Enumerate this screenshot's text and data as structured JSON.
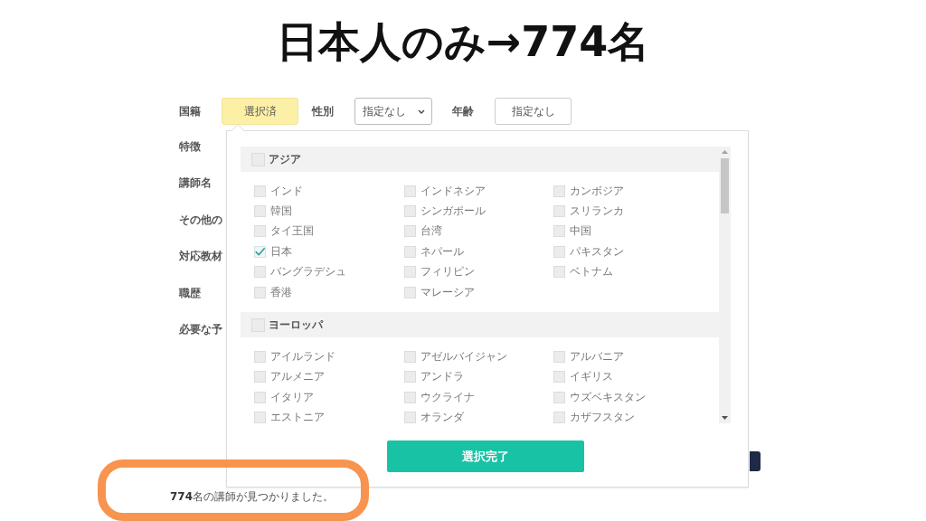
{
  "headline": "日本人のみ→774名",
  "filter_bar": [
    {
      "kind": "label",
      "text": "国籍"
    },
    {
      "kind": "toggle",
      "text": "選択済",
      "selected": true
    },
    {
      "kind": "label",
      "text": "性別"
    },
    {
      "kind": "select",
      "value": "指定なし"
    },
    {
      "kind": "label",
      "text": "年齢"
    },
    {
      "kind": "toggle",
      "text": "指定なし",
      "selected": false
    }
  ],
  "side_labels": [
    "特徴",
    "講師名",
    "その他の",
    "対応教材",
    "職歴",
    "必要な予"
  ],
  "country_popup": {
    "groups": [
      {
        "name": "アジア",
        "checked": false,
        "items": [
          {
            "label": "インド",
            "checked": false
          },
          {
            "label": "インドネシア",
            "checked": false
          },
          {
            "label": "カンボジア",
            "checked": false
          },
          {
            "label": "韓国",
            "checked": false
          },
          {
            "label": "シンガポール",
            "checked": false
          },
          {
            "label": "スリランカ",
            "checked": false
          },
          {
            "label": "タイ王国",
            "checked": false
          },
          {
            "label": "台湾",
            "checked": false
          },
          {
            "label": "中国",
            "checked": false
          },
          {
            "label": "日本",
            "checked": true
          },
          {
            "label": "ネパール",
            "checked": false
          },
          {
            "label": "パキスタン",
            "checked": false
          },
          {
            "label": "バングラデシュ",
            "checked": false
          },
          {
            "label": "フィリピン",
            "checked": false
          },
          {
            "label": "ベトナム",
            "checked": false
          },
          {
            "label": "香港",
            "checked": false
          },
          {
            "label": "マレーシア",
            "checked": false
          }
        ]
      },
      {
        "name": "ヨーロッパ",
        "checked": false,
        "items": [
          {
            "label": "アイルランド",
            "checked": false
          },
          {
            "label": "アゼルバイジャン",
            "checked": false
          },
          {
            "label": "アルバニア",
            "checked": false
          },
          {
            "label": "アルメニア",
            "checked": false
          },
          {
            "label": "アンドラ",
            "checked": false
          },
          {
            "label": "イギリス",
            "checked": false
          },
          {
            "label": "イタリア",
            "checked": false
          },
          {
            "label": "ウクライナ",
            "checked": false
          },
          {
            "label": "ウズベキスタン",
            "checked": false
          },
          {
            "label": "エストニア",
            "checked": false
          },
          {
            "label": "オランダ",
            "checked": false
          },
          {
            "label": "カザフスタン",
            "checked": false
          }
        ]
      }
    ],
    "confirm_button": "選択完了"
  },
  "result_text": "**774**名の講師が見つかりました。"
}
